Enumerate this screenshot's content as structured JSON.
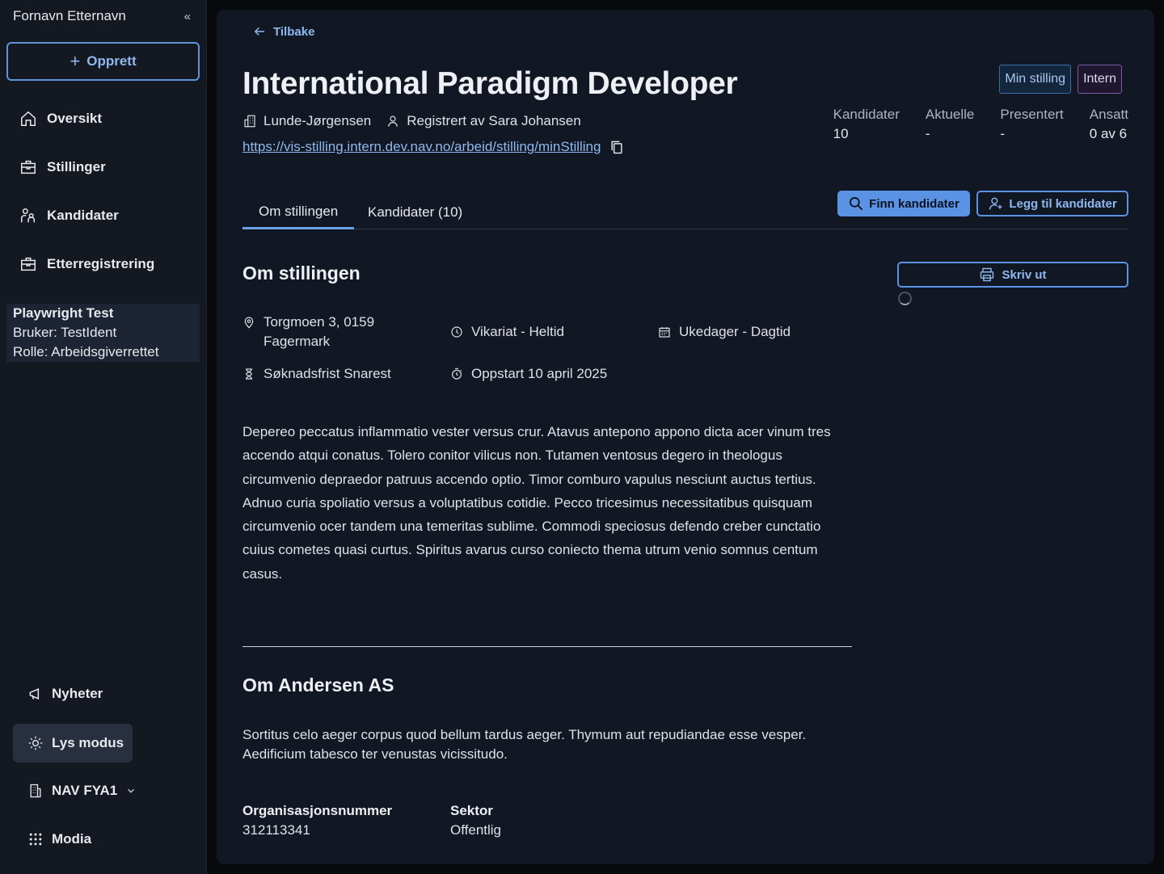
{
  "sidebar": {
    "user_name": "Fornavn Etternavn",
    "create_label": "Opprett",
    "nav": [
      {
        "label": "Oversikt",
        "icon": "home-icon"
      },
      {
        "label": "Stillinger",
        "icon": "briefcase-icon"
      },
      {
        "label": "Kandidater",
        "icon": "people-icon"
      },
      {
        "label": "Etterregistrering",
        "icon": "briefcase-icon"
      }
    ],
    "test_box": {
      "line1": "Playwright Test",
      "line2": "Bruker: TestIdent",
      "line3": "Rolle: Arbeidsgiverrettet"
    },
    "bottom": {
      "news": "Nyheter",
      "theme": "Lys modus",
      "office": "NAV FYA1",
      "apps": "Modia"
    }
  },
  "main": {
    "back_label": "Tilbake",
    "title": "International Paradigm Developer",
    "employer": "Lunde-Jørgensen",
    "registered_by": "Registrert av Sara Johansen",
    "link": "https://vis-stilling.intern.dev.nav.no/arbeid/stilling/minStilling",
    "tags": {
      "mine": "Min stilling",
      "internal": "Intern"
    },
    "stats": [
      {
        "label": "Kandidater",
        "value": "10"
      },
      {
        "label": "Aktuelle",
        "value": "-"
      },
      {
        "label": "Presentert",
        "value": "-"
      },
      {
        "label": "Ansatt",
        "value": "0 av 6"
      }
    ],
    "tabs": {
      "about": "Om stillingen",
      "candidates": "Kandidater (10)"
    },
    "buttons": {
      "find": "Finn kandidater",
      "add": "Legg til kandidater",
      "print": "Skriv ut"
    },
    "section_about": "Om stillingen",
    "info": {
      "address_line1": "Torgmoen 3, 0159",
      "address_line2": "Fagermark",
      "employment": "Vikariat - Heltid",
      "schedule": "Ukedager - Dagtid",
      "deadline": "Søknadsfrist Snarest",
      "start": "Oppstart 10 april 2025"
    },
    "description": "Depereo peccatus inflammatio vester versus crur. Atavus antepono appono dicta acer vinum tres accendo atqui conatus. Tolero conitor vilicus non. Tutamen ventosus degero in theologus circumvenio depraedor patruus accendo optio. Timor comburo vapulus nesciunt auctus tertius. Adnuo curia spoliatio versus a voluptatibus cotidie. Pecco tricesimus necessitatibus quisquam circumvenio ocer tandem una temeritas sublime. Commodi speciosus defendo creber cunctatio cuius cometes quasi curtus. Spiritus avarus curso coniecto thema utrum venio somnus centum casus.",
    "section_company": "Om Andersen AS",
    "company_text_1": "Sortitus celo aeger corpus quod bellum tardus aeger. Thymum aut repudiandae esse vesper.",
    "company_text_2": "Aedificium tabesco ter venustas vicissitudo.",
    "org_label": "Organisasjonsnummer",
    "org_value": "312113341",
    "sector_label": "Sektor",
    "sector_value": "Offentlig"
  }
}
